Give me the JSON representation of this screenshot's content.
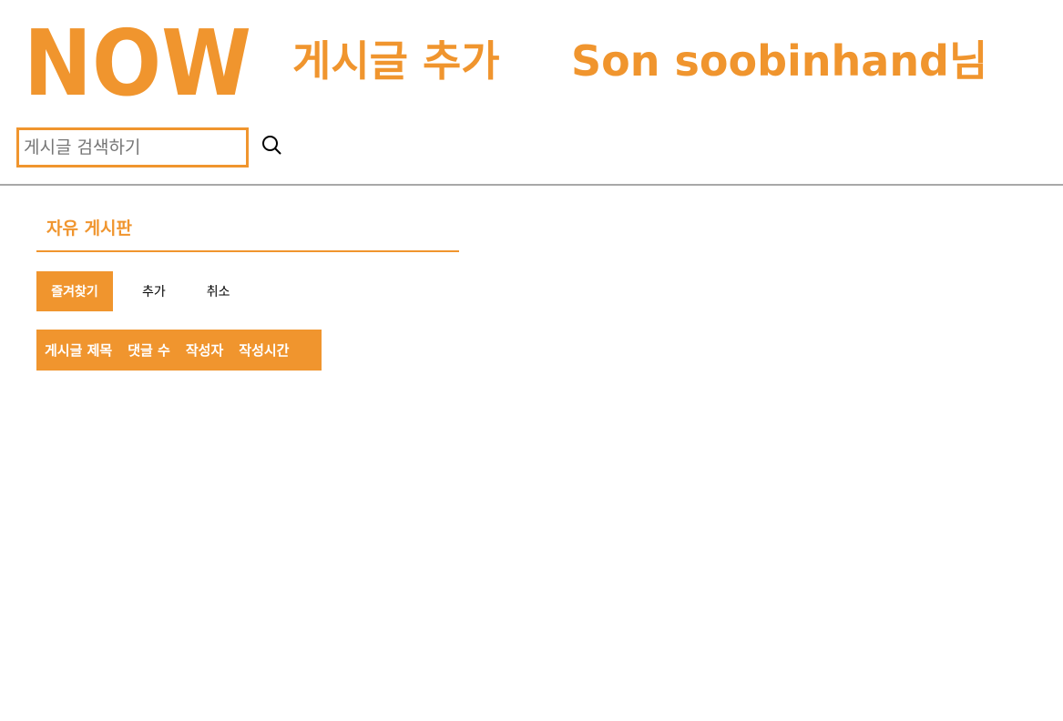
{
  "header": {
    "logo_text": "NOW",
    "page_title": "게시글 추가",
    "user_greeting": "Son soobinhand님"
  },
  "search": {
    "placeholder": "게시글 검색하기",
    "value": "",
    "button_icon": "search-icon"
  },
  "board": {
    "title": "자유 게시판"
  },
  "actions": {
    "favorite_label": "즐겨찾기",
    "add_label": "추가",
    "cancel_label": "취소"
  },
  "table": {
    "columns": [
      "게시글 제목",
      "댓글 수",
      "작성자",
      "작성시간"
    ],
    "rows": []
  },
  "colors": {
    "accent": "#f0952e",
    "divider": "#a8a8a8",
    "background": "#ffffff"
  }
}
